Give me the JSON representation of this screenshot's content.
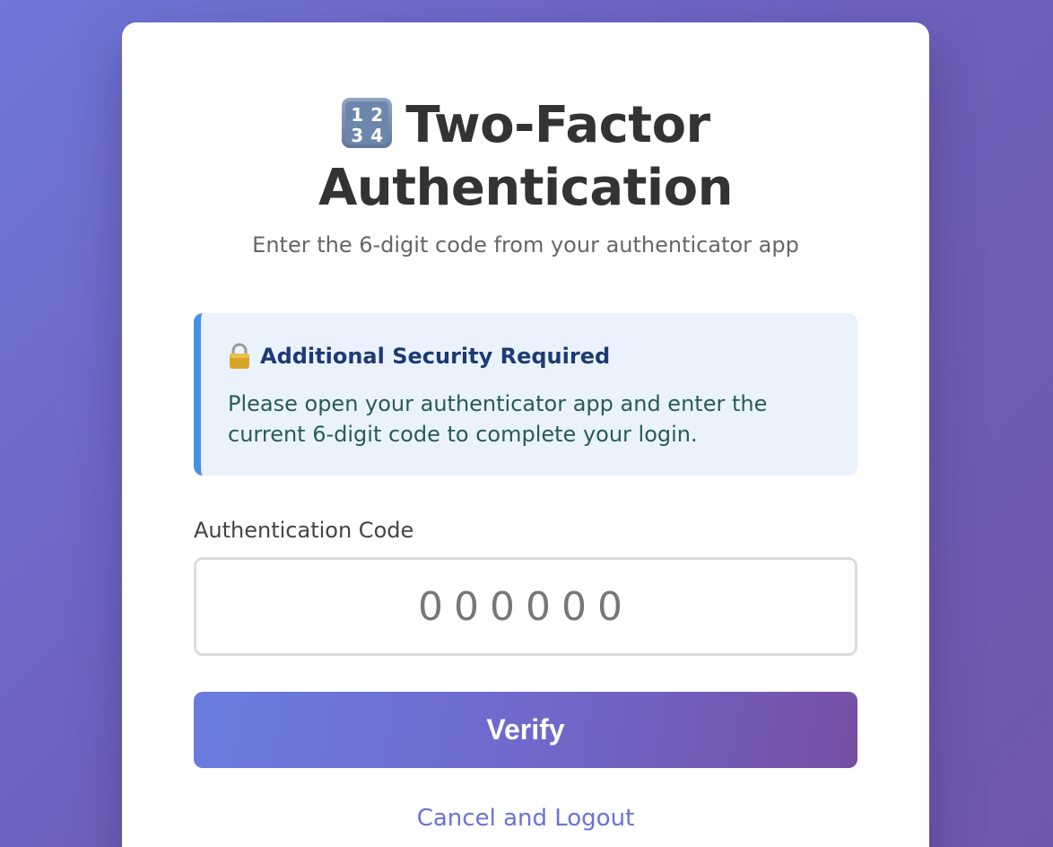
{
  "header": {
    "title_icon": "numbers-keycap-icon",
    "title": "Two-Factor Authentication",
    "subtitle": "Enter the 6-digit code from your authenticator app"
  },
  "info_box": {
    "icon": "lock-icon",
    "title": "Additional Security Required",
    "text": "Please open your authenticator app and enter the current 6-digit code to complete your login."
  },
  "form": {
    "code_label": "Authentication Code",
    "code_placeholder": "000000",
    "code_value": "",
    "verify_label": "Verify",
    "cancel_label": "Cancel and Logout"
  },
  "colors": {
    "accent": "#6b72d8",
    "info_border": "#4a90e2",
    "info_background": "#eaf3fd",
    "info_title": "#1e3a75",
    "button_gradient_start": "#6b7ce0",
    "button_gradient_end": "#764fa4"
  }
}
